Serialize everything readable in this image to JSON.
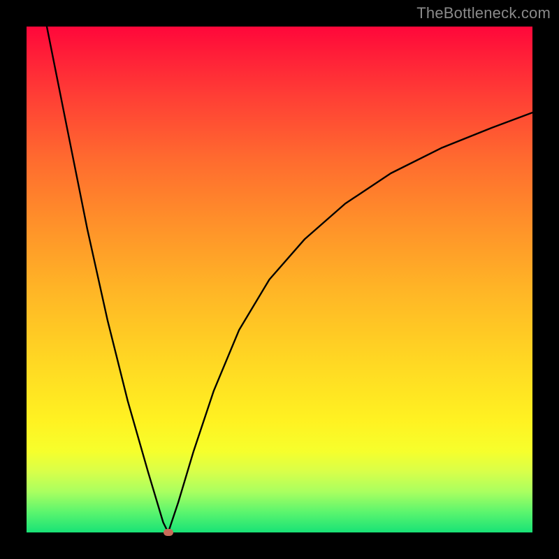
{
  "watermark": "TheBottleneck.com",
  "chart_data": {
    "type": "line",
    "title": "",
    "xlabel": "",
    "ylabel": "",
    "xlim": [
      0,
      100
    ],
    "ylim": [
      0,
      100
    ],
    "grid": false,
    "legend": false,
    "background_gradient": {
      "top": "#ff073a",
      "upper_mid": "#ff8e2a",
      "mid": "#ffd723",
      "lower_mid": "#f6ff2c",
      "bottom": "#18e276"
    },
    "marker": {
      "x": 28,
      "y": 0,
      "color": "#c96b59"
    },
    "series": [
      {
        "name": "left-branch",
        "x": [
          4,
          8,
          12,
          16,
          20,
          24,
          27,
          28
        ],
        "y": [
          100,
          80,
          60,
          42,
          26,
          12,
          2,
          0
        ]
      },
      {
        "name": "right-branch",
        "x": [
          28,
          30,
          33,
          37,
          42,
          48,
          55,
          63,
          72,
          82,
          92,
          100
        ],
        "y": [
          0,
          6,
          16,
          28,
          40,
          50,
          58,
          65,
          71,
          76,
          80,
          83
        ]
      }
    ]
  }
}
